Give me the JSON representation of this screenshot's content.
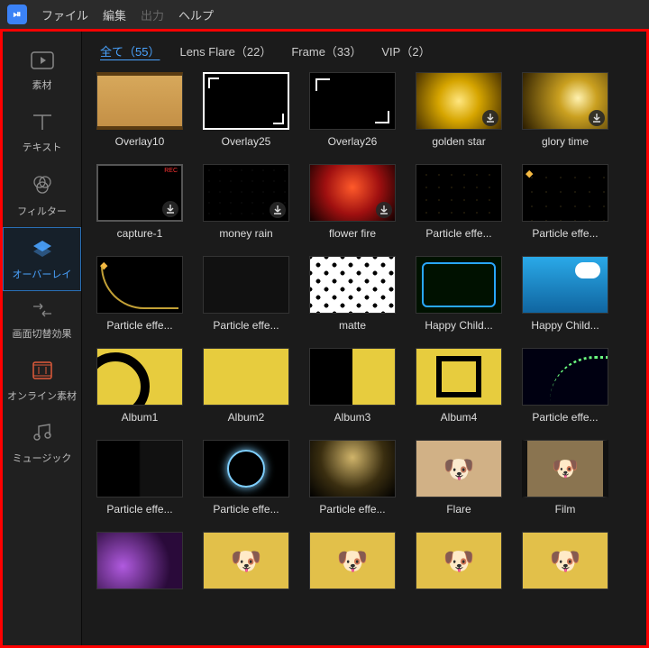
{
  "menu": {
    "file": "ファイル",
    "edit": "編集",
    "output": "出力",
    "help": "ヘルプ"
  },
  "sidebar": {
    "items": [
      {
        "label": "素材"
      },
      {
        "label": "テキスト"
      },
      {
        "label": "フィルター"
      },
      {
        "label": "オーバーレイ"
      },
      {
        "label": "画面切替効果"
      },
      {
        "label": "オンライン素材"
      },
      {
        "label": "ミュージック"
      }
    ]
  },
  "tabs": [
    {
      "label": "全て（55）",
      "active": true
    },
    {
      "label": "Lens Flare（22）"
    },
    {
      "label": "Frame（33）"
    },
    {
      "label": "VIP（2）"
    }
  ],
  "items": [
    {
      "label": "Overlay10",
      "cls": "th-ov10"
    },
    {
      "label": "Overlay25",
      "cls": "th-ov25"
    },
    {
      "label": "Overlay26",
      "cls": "th-ov26"
    },
    {
      "label": "golden star",
      "cls": "th-gold",
      "dl": true
    },
    {
      "label": "glory time",
      "cls": "th-glory",
      "dl": true
    },
    {
      "label": "capture-1",
      "cls": "th-cap1",
      "dl": true
    },
    {
      "label": "money rain",
      "cls": "th-money",
      "dl": true
    },
    {
      "label": "flower fire",
      "cls": "th-fire",
      "dl": true
    },
    {
      "label": "Particle effe...",
      "cls": "th-spark"
    },
    {
      "label": "Particle effe...",
      "cls": "th-spark2",
      "vip": true
    },
    {
      "label": "Particle effe...",
      "cls": "th-glow",
      "vip": true
    },
    {
      "label": "Particle effe...",
      "cls": "th-bokeh"
    },
    {
      "label": "matte",
      "cls": "th-matte"
    },
    {
      "label": "Happy Child...",
      "cls": "th-neon"
    },
    {
      "label": "Happy Child...",
      "cls": "th-cloud"
    },
    {
      "label": "Album1",
      "cls": "th-alb1"
    },
    {
      "label": "Album2",
      "cls": "th-alb2"
    },
    {
      "label": "Album3",
      "cls": "th-alb3"
    },
    {
      "label": "Album4",
      "cls": "th-alb4"
    },
    {
      "label": "Particle effe...",
      "cls": "th-green"
    },
    {
      "label": "Particle effe...",
      "cls": "th-dualspark"
    },
    {
      "label": "Particle effe...",
      "cls": "th-ring"
    },
    {
      "label": "Particle effe...",
      "cls": "th-dust"
    },
    {
      "label": "Flare",
      "cls": "th-dog"
    },
    {
      "label": "Film",
      "cls": "th-dogfilm"
    },
    {
      "label": "",
      "cls": "th-purple"
    },
    {
      "label": "",
      "cls": "th-dogy"
    },
    {
      "label": "",
      "cls": "th-dogy"
    },
    {
      "label": "",
      "cls": "th-dogy"
    },
    {
      "label": "",
      "cls": "th-dogy"
    }
  ]
}
